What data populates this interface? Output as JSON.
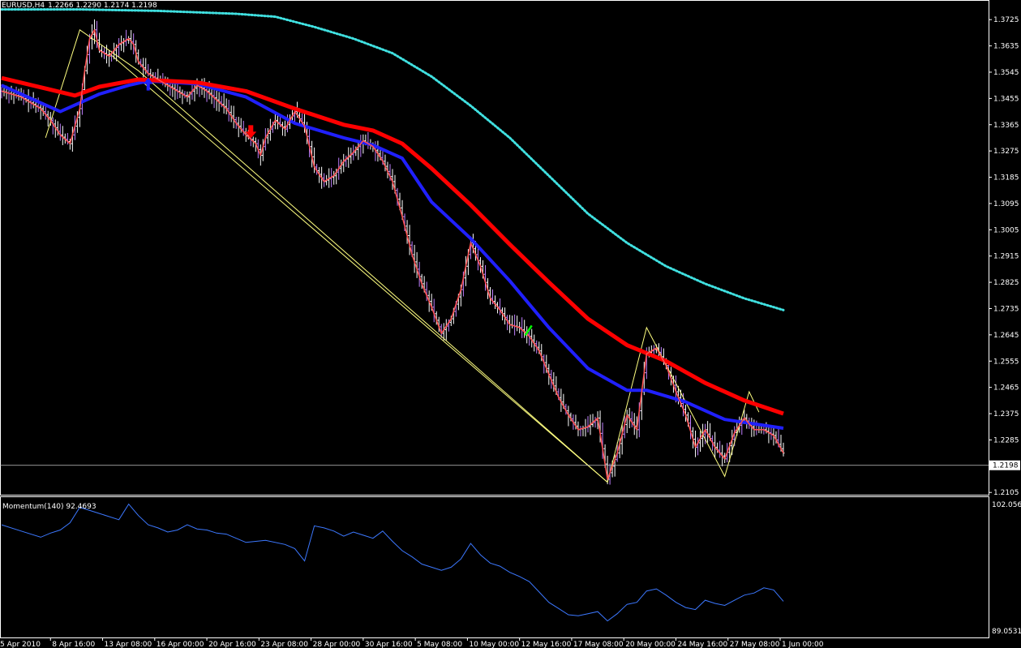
{
  "header": {
    "symbol": "EURUSD,H4",
    "ohlc": "1.2266 1.2290 1.2174 1.2198"
  },
  "indicator": {
    "label": "Momentum(140) 92.4693"
  },
  "colors": {
    "background": "#000000",
    "bars": "#ffffff",
    "bars_alt": "#c080ff",
    "fast_ma": "#ff5050",
    "ma_red": "#ff0000",
    "ma_blue": "#2020ff",
    "ma_dotted": "#40e0e0",
    "zigzag": "#ffff80",
    "momentum": "#3c78ff",
    "signal_down": "#ff0000",
    "signal_up": "#00ff00",
    "signal_blue": "#2020ff"
  },
  "chart_data": [
    {
      "type": "line",
      "title": "",
      "price_axis": {
        "ticks": [
          "1.3725",
          "1.3635",
          "1.3545",
          "1.3455",
          "1.3365",
          "1.3275",
          "1.3185",
          "1.3095",
          "1.3005",
          "1.2915",
          "1.2825",
          "1.2735",
          "1.2645",
          "1.2555",
          "1.2465",
          "1.2375",
          "1.2285",
          "1.2105"
        ],
        "current_price": "1.2198",
        "ylim": [
          1.21,
          1.377
        ]
      },
      "time_axis": {
        "ticks": [
          "5 Apr 2010",
          "8 Apr 16:00",
          "13 Apr 08:00",
          "16 Apr 00:00",
          "20 Apr 16:00",
          "23 Apr 08:00",
          "28 Apr 00:00",
          "30 Apr 16:00",
          "5 May 08:00",
          "10 May 00:00",
          "12 May 16:00",
          "17 May 08:00",
          "20 May 00:00",
          "24 May 16:00",
          "27 May 08:00",
          "1 Jun 00:00"
        ],
        "bar_range": [
          0,
          320
        ]
      },
      "series": [
        {
          "key": "price",
          "points": [
            [
              0,
              1.348
            ],
            [
              8,
              1.346
            ],
            [
              16,
              1.342
            ],
            [
              20,
              1.338
            ],
            [
              24,
              1.333
            ],
            [
              28,
              1.33
            ],
            [
              32,
              1.342
            ],
            [
              34,
              1.355
            ],
            [
              36,
              1.366
            ],
            [
              38,
              1.369
            ],
            [
              40,
              1.362
            ],
            [
              44,
              1.36
            ],
            [
              48,
              1.364
            ],
            [
              52,
              1.366
            ],
            [
              54,
              1.364
            ],
            [
              56,
              1.358
            ],
            [
              60,
              1.354
            ],
            [
              64,
              1.352
            ],
            [
              68,
              1.35
            ],
            [
              72,
              1.348
            ],
            [
              76,
              1.346
            ],
            [
              80,
              1.35
            ],
            [
              84,
              1.348
            ],
            [
              88,
              1.345
            ],
            [
              92,
              1.342
            ],
            [
              96,
              1.337
            ],
            [
              100,
              1.333
            ],
            [
              104,
              1.33
            ],
            [
              106,
              1.326
            ],
            [
              108,
              1.332
            ],
            [
              112,
              1.338
            ],
            [
              116,
              1.335
            ],
            [
              120,
              1.341
            ],
            [
              124,
              1.336
            ],
            [
              128,
              1.322
            ],
            [
              132,
              1.317
            ],
            [
              136,
              1.319
            ],
            [
              140,
              1.324
            ],
            [
              144,
              1.327
            ],
            [
              148,
              1.331
            ],
            [
              152,
              1.329
            ],
            [
              156,
              1.324
            ],
            [
              160,
              1.317
            ],
            [
              164,
              1.305
            ],
            [
              168,
              1.292
            ],
            [
              172,
              1.282
            ],
            [
              176,
              1.274
            ],
            [
              180,
              1.265
            ],
            [
              184,
              1.27
            ],
            [
              188,
              1.28
            ],
            [
              192,
              1.296
            ],
            [
              196,
              1.288
            ],
            [
              200,
              1.277
            ],
            [
              204,
              1.273
            ],
            [
              208,
              1.268
            ],
            [
              212,
              1.267
            ],
            [
              216,
              1.264
            ],
            [
              220,
              1.259
            ],
            [
              224,
              1.251
            ],
            [
              228,
              1.243
            ],
            [
              232,
              1.237
            ],
            [
              236,
              1.232
            ],
            [
              240,
              1.233
            ],
            [
              244,
              1.236
            ],
            [
              248,
              1.215
            ],
            [
              252,
              1.224
            ],
            [
              256,
              1.237
            ],
            [
              260,
              1.232
            ],
            [
              264,
              1.258
            ],
            [
              268,
              1.26
            ],
            [
              272,
              1.254
            ],
            [
              276,
              1.245
            ],
            [
              280,
              1.237
            ],
            [
              284,
              1.226
            ],
            [
              288,
              1.232
            ],
            [
              292,
              1.226
            ],
            [
              296,
              1.222
            ],
            [
              300,
              1.231
            ],
            [
              304,
              1.236
            ],
            [
              308,
              1.232
            ],
            [
              312,
              1.232
            ],
            [
              316,
              1.23
            ],
            [
              320,
              1.224
            ]
          ]
        },
        {
          "key": "ma_red",
          "points": [
            [
              0,
              1.3525
            ],
            [
              20,
              1.3485
            ],
            [
              30,
              1.3465
            ],
            [
              40,
              1.3495
            ],
            [
              56,
              1.352
            ],
            [
              80,
              1.351
            ],
            [
              100,
              1.348
            ],
            [
              120,
              1.342
            ],
            [
              140,
              1.3365
            ],
            [
              152,
              1.3345
            ],
            [
              164,
              1.33
            ],
            [
              176,
              1.3215
            ],
            [
              192,
              1.309
            ],
            [
              208,
              1.2955
            ],
            [
              224,
              1.2825
            ],
            [
              240,
              1.27
            ],
            [
              256,
              1.261
            ],
            [
              272,
              1.2555
            ],
            [
              288,
              1.248
            ],
            [
              304,
              1.242
            ],
            [
              320,
              1.2375
            ]
          ]
        },
        {
          "key": "ma_blue",
          "points": [
            [
              0,
              1.35
            ],
            [
              16,
              1.344
            ],
            [
              24,
              1.341
            ],
            [
              32,
              1.344
            ],
            [
              40,
              1.347
            ],
            [
              52,
              1.35
            ],
            [
              60,
              1.3515
            ],
            [
              80,
              1.3505
            ],
            [
              100,
              1.346
            ],
            [
              120,
              1.337
            ],
            [
              140,
              1.332
            ],
            [
              152,
              1.3295
            ],
            [
              164,
              1.325
            ],
            [
              176,
              1.31
            ],
            [
              192,
              1.2975
            ],
            [
              208,
              1.283
            ],
            [
              224,
              1.267
            ],
            [
              240,
              1.253
            ],
            [
              256,
              1.2455
            ],
            [
              264,
              1.2455
            ],
            [
              280,
              1.2415
            ],
            [
              296,
              1.2355
            ],
            [
              320,
              1.2325
            ]
          ]
        },
        {
          "key": "ma_dotted",
          "points": [
            [
              0,
              1.376
            ],
            [
              32,
              1.376
            ],
            [
              64,
              1.3755
            ],
            [
              80,
              1.375
            ],
            [
              96,
              1.3745
            ],
            [
              112,
              1.3735
            ],
            [
              128,
              1.37
            ],
            [
              144,
              1.366
            ],
            [
              160,
              1.361
            ],
            [
              176,
              1.353
            ],
            [
              192,
              1.343
            ],
            [
              208,
              1.332
            ],
            [
              224,
              1.319
            ],
            [
              240,
              1.306
            ],
            [
              256,
              1.296
            ],
            [
              272,
              1.288
            ],
            [
              288,
              1.282
            ],
            [
              304,
              1.277
            ],
            [
              320,
              1.273
            ]
          ]
        },
        {
          "key": "zigzag",
          "points": [
            [
              18,
              1.332
            ],
            [
              32,
              1.369
            ],
            [
              56,
              1.355
            ],
            [
              248,
              1.214
            ],
            [
              264,
              1.267
            ],
            [
              296,
              1.216
            ],
            [
              306,
              1.245
            ],
            [
              310,
              1.238
            ]
          ]
        },
        {
          "key": "channel_line",
          "points": [
            [
              44,
              1.361
            ],
            [
              248,
              1.214
            ]
          ]
        }
      ],
      "signals": [
        {
          "type": "arrow-down",
          "x": 102,
          "price": 1.333
        },
        {
          "type": "arrow-up",
          "x": 60,
          "price": 1.351
        },
        {
          "type": "tick-up",
          "x": 216,
          "price": 1.266
        }
      ]
    },
    {
      "type": "line",
      "title": "Momentum(140) 92.4693",
      "axis_ticks": [
        "102.056",
        "89.0531"
      ],
      "ylim": [
        89.0,
        102.5
      ],
      "series": [
        {
          "name": "Momentum(140)",
          "points": [
            [
              0,
              99.9
            ],
            [
              8,
              99.3
            ],
            [
              16,
              98.7
            ],
            [
              20,
              99.1
            ],
            [
              24,
              99.4
            ],
            [
              28,
              100.1
            ],
            [
              32,
              101.6
            ],
            [
              40,
              101.0
            ],
            [
              48,
              100.4
            ],
            [
              52,
              101.9
            ],
            [
              56,
              100.8
            ],
            [
              60,
              99.9
            ],
            [
              64,
              99.6
            ],
            [
              68,
              99.2
            ],
            [
              72,
              99.4
            ],
            [
              76,
              99.9
            ],
            [
              80,
              99.5
            ],
            [
              84,
              99.4
            ],
            [
              88,
              99.1
            ],
            [
              92,
              99.0
            ],
            [
              96,
              98.6
            ],
            [
              100,
              98.2
            ],
            [
              108,
              98.4
            ],
            [
              116,
              98.0
            ],
            [
              120,
              97.6
            ],
            [
              124,
              96.4
            ],
            [
              128,
              99.8
            ],
            [
              132,
              99.6
            ],
            [
              136,
              99.3
            ],
            [
              140,
              98.8
            ],
            [
              144,
              99.2
            ],
            [
              148,
              98.9
            ],
            [
              152,
              98.6
            ],
            [
              156,
              99.3
            ],
            [
              160,
              98.3
            ],
            [
              164,
              97.4
            ],
            [
              168,
              96.8
            ],
            [
              172,
              96.1
            ],
            [
              176,
              95.8
            ],
            [
              180,
              95.5
            ],
            [
              184,
              95.8
            ],
            [
              188,
              96.6
            ],
            [
              192,
              98.1
            ],
            [
              196,
              97.0
            ],
            [
              200,
              96.2
            ],
            [
              204,
              95.9
            ],
            [
              208,
              95.3
            ],
            [
              212,
              94.9
            ],
            [
              216,
              94.4
            ],
            [
              220,
              93.4
            ],
            [
              224,
              92.4
            ],
            [
              228,
              91.8
            ],
            [
              232,
              91.2
            ],
            [
              236,
              91.1
            ],
            [
              240,
              91.3
            ],
            [
              244,
              91.5
            ],
            [
              248,
              90.6
            ],
            [
              252,
              91.3
            ],
            [
              256,
              92.2
            ],
            [
              260,
              92.4
            ],
            [
              264,
              93.5
            ],
            [
              268,
              93.7
            ],
            [
              272,
              93.1
            ],
            [
              276,
              92.4
            ],
            [
              280,
              91.9
            ],
            [
              284,
              91.7
            ],
            [
              288,
              92.6
            ],
            [
              292,
              92.3
            ],
            [
              296,
              92.1
            ],
            [
              300,
              92.6
            ],
            [
              304,
              93.1
            ],
            [
              308,
              93.3
            ],
            [
              312,
              93.8
            ],
            [
              316,
              93.6
            ],
            [
              320,
              92.5
            ]
          ]
        }
      ]
    }
  ]
}
